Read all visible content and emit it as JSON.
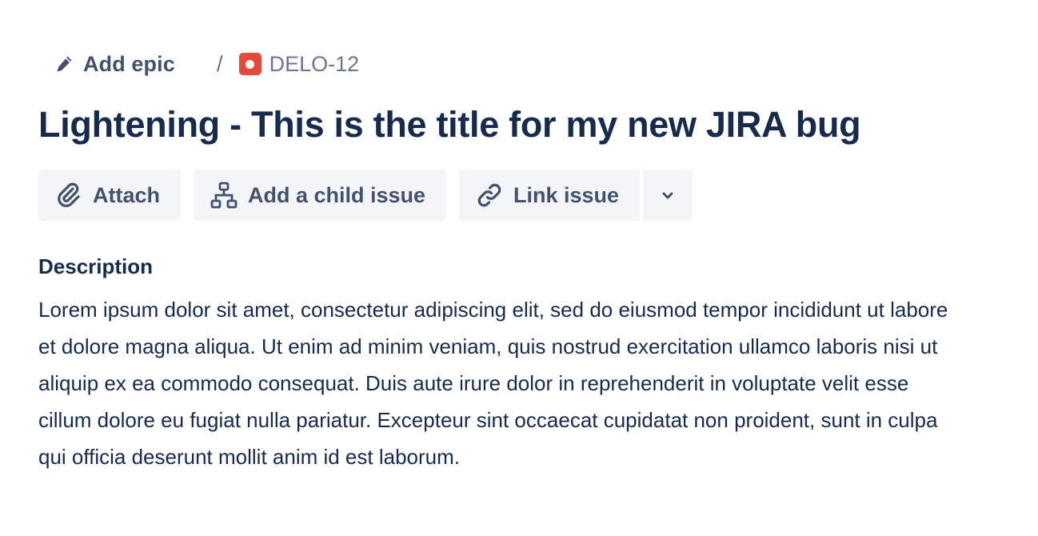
{
  "breadcrumb": {
    "epic_label": "Add epic",
    "separator": "/",
    "issue_key": "DELO-12",
    "issue_type_icon": "bug-icon",
    "epic_icon": "pencil-icon"
  },
  "issue": {
    "title": "Lightening - This is the title for my new JIRA bug"
  },
  "toolbar": {
    "attach_label": "Attach",
    "attach_icon": "paperclip-icon",
    "child_label": "Add a child issue",
    "child_icon": "hierarchy-icon",
    "link_label": "Link issue",
    "link_icon": "link-icon",
    "more_icon": "chevron-down-icon"
  },
  "description": {
    "heading": "Description",
    "body": "Lorem ipsum dolor sit amet, consectetur adipiscing elit, sed do eiusmod tempor incididunt ut labore et dolore magna aliqua. Ut enim ad minim veniam, quis nostrud exercitation ullamco laboris nisi ut aliquip ex ea commodo consequat. Duis aute irure dolor in reprehenderit in voluptate velit esse cillum dolore eu fugiat nulla pariatur. Excepteur sint occaecat cupidatat non proident, sunt in culpa qui officia deserunt mollit anim id est laborum."
  },
  "colors": {
    "text_primary": "#172b4d",
    "text_secondary": "#42526e",
    "text_subtle": "#6b778c",
    "button_bg": "#f4f5f7",
    "bug_red": "#e5493a"
  }
}
